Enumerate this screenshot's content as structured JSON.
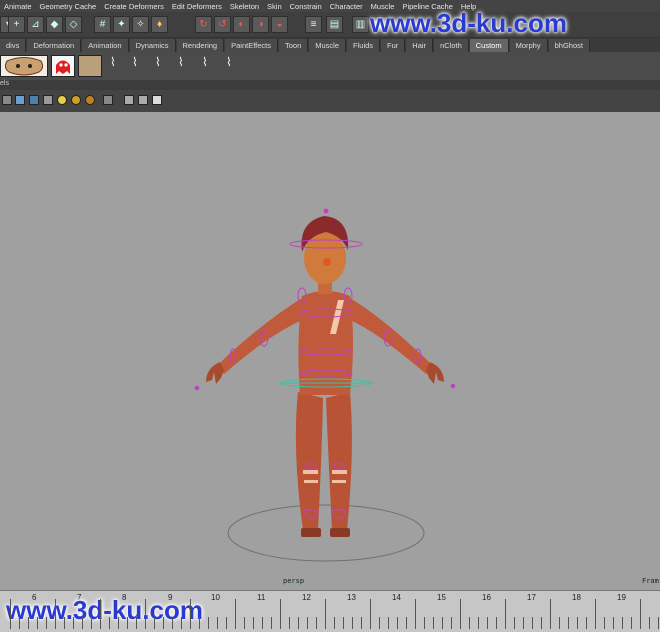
{
  "menu": [
    "Animate",
    "Geometry Cache",
    "Create Deformers",
    "Edit Deformers",
    "Skeleton",
    "Skin",
    "Constrain",
    "Character",
    "Muscle",
    "Pipeline Cache",
    "Help"
  ],
  "shelf_tabs": [
    "divs",
    "Deformation",
    "Animation",
    "Dynamics",
    "Rendering",
    "PaintEffects",
    "Toon",
    "Muscle",
    "Fluids",
    "Fur",
    "Hair",
    "nCloth",
    "Custom",
    "Morphy",
    "bhGhost"
  ],
  "active_shelf_tab": "Custom",
  "panel_menu_fragment": "els",
  "viewport": {
    "camera_label": "persp",
    "frame_label": "Fram"
  },
  "timeline": {
    "ticks": [
      "6",
      "7",
      "8",
      "9",
      "10",
      "11",
      "12",
      "13",
      "14",
      "15",
      "16",
      "17",
      "18",
      "19"
    ]
  },
  "watermark": "www.3d-ku.com",
  "colors": {
    "viewport_bg": "#a0a0a0",
    "character_skin": "#c05a3a",
    "controls": "#c040c0",
    "pivot": "#40c0a0"
  }
}
